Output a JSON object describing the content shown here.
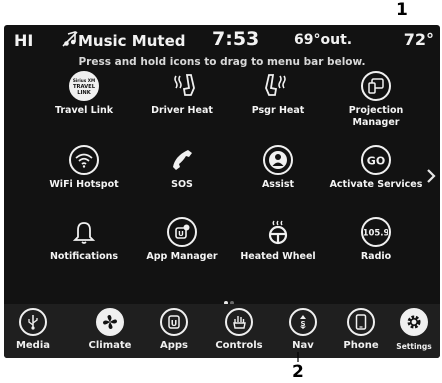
{
  "callouts": {
    "top": "1",
    "bottom": "2"
  },
  "status_bar": {
    "profile": "HI",
    "media_status": "Music Muted",
    "muted_icon": "muted-music-note-icon",
    "time": "7:53",
    "outside_temp": "69°out.",
    "cabin_temp": "72°"
  },
  "hint": "Press and hold icons to drag to menu bar below.",
  "apps": [
    {
      "label": "Travel Link",
      "icon": "travel-link-icon",
      "icon_text": "Sirius XM TRAVEL LINK"
    },
    {
      "label": "Driver Heat",
      "icon": "heated-seat-icon"
    },
    {
      "label": "Psgr Heat",
      "icon": "heated-seat-icon"
    },
    {
      "label": "Projection Manager",
      "icon": "projection-manager-icon"
    },
    {
      "label": "WiFi Hotspot",
      "icon": "wifi-icon"
    },
    {
      "label": "SOS",
      "icon": "phone-handset-icon"
    },
    {
      "label": "Assist",
      "icon": "assist-person-icon"
    },
    {
      "label": "Activate Services",
      "icon": "go-icon",
      "icon_text": "GO"
    },
    {
      "label": "Notifications",
      "icon": "bell-icon"
    },
    {
      "label": "App Manager",
      "icon": "app-manager-icon"
    },
    {
      "label": "Heated Wheel",
      "icon": "heated-wheel-icon"
    },
    {
      "label": "Radio",
      "icon": "radio-icon",
      "icon_text": "105.9"
    }
  ],
  "page_dots": {
    "count": 2,
    "active": 0
  },
  "menu_bar": [
    {
      "label": "Media",
      "icon": "media-usb-icon"
    },
    {
      "label": "Climate",
      "icon": "climate-fan-icon"
    },
    {
      "label": "Apps",
      "icon": "apps-icon"
    },
    {
      "label": "Controls",
      "icon": "controls-hand-icon"
    },
    {
      "label": "Nav",
      "icon": "nav-compass-icon"
    },
    {
      "label": "Phone",
      "icon": "phone-icon"
    },
    {
      "label": "Settings",
      "icon": "settings-gear-icon"
    }
  ],
  "colors": {
    "background": "#121212",
    "menu_bar": "#1f1f1f",
    "foreground": "#f0f0f0"
  }
}
